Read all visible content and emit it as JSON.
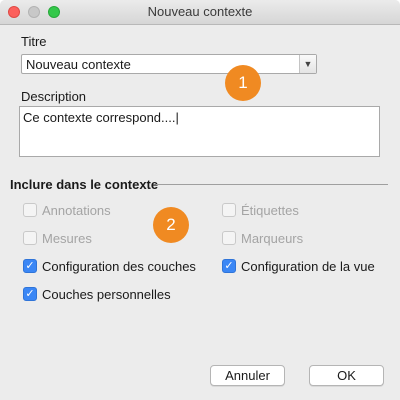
{
  "window": {
    "title": "Nouveau contexte"
  },
  "form": {
    "title_label": "Titre",
    "title_value": "Nouveau contexte",
    "description_label": "Description",
    "description_value": "Ce contexte correspond....|"
  },
  "section": {
    "title": "Inclure dans le contexte"
  },
  "options": {
    "annotations": {
      "label": "Annotations",
      "checked": false,
      "enabled": false
    },
    "etiquettes": {
      "label": "Étiquettes",
      "checked": false,
      "enabled": false
    },
    "mesures": {
      "label": "Mesures",
      "checked": false,
      "enabled": false
    },
    "marqueurs": {
      "label": "Marqueurs",
      "checked": false,
      "enabled": false
    },
    "config_couches": {
      "label": "Configuration des couches",
      "checked": true,
      "enabled": true
    },
    "config_vue": {
      "label": "Configuration de la vue",
      "checked": true,
      "enabled": true
    },
    "couches_perso": {
      "label": "Couches personnelles",
      "checked": true,
      "enabled": true
    }
  },
  "badges": {
    "one": "1",
    "two": "2"
  },
  "buttons": {
    "cancel": "Annuler",
    "ok": "OK"
  },
  "colors": {
    "accent": "#3b87f5",
    "badge": "#f08a22"
  }
}
